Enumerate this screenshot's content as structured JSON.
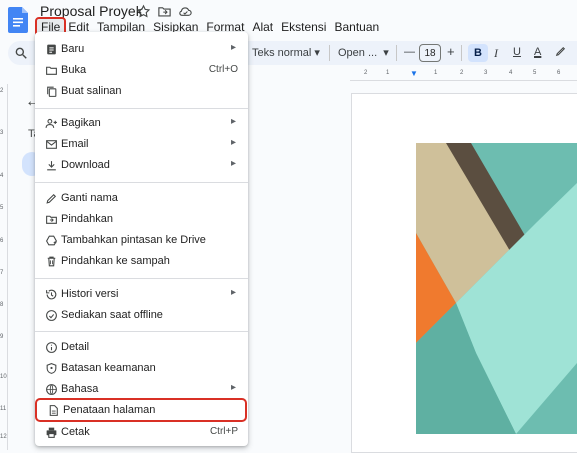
{
  "app": {
    "title": "Proposal Proyek",
    "menus": [
      "File",
      "Edit",
      "Tampilan",
      "Sisipkan",
      "Format",
      "Alat",
      "Ekstensi",
      "Bantuan"
    ],
    "active_menu": "File"
  },
  "toolbar": {
    "style": "Teks normal",
    "font": "Open ...",
    "font_size": "18",
    "minus": "—",
    "plus": "+",
    "bold": "B",
    "italic": "I",
    "underline": "U",
    "text_color": "A"
  },
  "left_panel": {
    "label": "Ta"
  },
  "ruler": {
    "numbers": [
      "2",
      "1",
      "1",
      "2",
      "3",
      "4",
      "5",
      "6"
    ]
  },
  "vruler": {
    "numbers": [
      "2",
      "3",
      "4",
      "5",
      "6",
      "7",
      "8",
      "9",
      "10",
      "11",
      "12"
    ]
  },
  "file_menu": {
    "items": [
      {
        "label": "Baru",
        "icon": "doc-icon",
        "submenu": true,
        "shortcut": ""
      },
      {
        "label": "Buka",
        "icon": "folder-icon",
        "submenu": false,
        "shortcut": "Ctrl+O"
      },
      {
        "label": "Buat salinan",
        "icon": "copy-icon",
        "submenu": false,
        "shortcut": ""
      },
      {
        "label": "Bagikan",
        "icon": "share-person-icon",
        "submenu": true,
        "shortcut": ""
      },
      {
        "label": "Email",
        "icon": "email-icon",
        "submenu": true,
        "shortcut": ""
      },
      {
        "label": "Download",
        "icon": "download-icon",
        "submenu": true,
        "shortcut": ""
      },
      {
        "label": "Ganti nama",
        "icon": "pencil-icon",
        "submenu": false,
        "shortcut": ""
      },
      {
        "label": "Pindahkan",
        "icon": "move-folder-icon",
        "submenu": false,
        "shortcut": ""
      },
      {
        "label": "Tambahkan pintasan ke Drive",
        "icon": "drive-shortcut-icon",
        "submenu": false,
        "shortcut": ""
      },
      {
        "label": "Pindahkan ke sampah",
        "icon": "trash-icon",
        "submenu": false,
        "shortcut": ""
      },
      {
        "label": "Histori versi",
        "icon": "history-icon",
        "submenu": true,
        "shortcut": ""
      },
      {
        "label": "Sediakan saat offline",
        "icon": "offline-icon",
        "submenu": false,
        "shortcut": ""
      },
      {
        "label": "Detail",
        "icon": "info-icon",
        "submenu": false,
        "shortcut": ""
      },
      {
        "label": "Batasan keamanan",
        "icon": "shield-icon",
        "submenu": false,
        "shortcut": ""
      },
      {
        "label": "Bahasa",
        "icon": "globe-icon",
        "submenu": true,
        "shortcut": ""
      },
      {
        "label": "Penataan halaman",
        "icon": "page-setup-icon",
        "submenu": false,
        "shortcut": ""
      },
      {
        "label": "Cetak",
        "icon": "print-icon",
        "submenu": false,
        "shortcut": "Ctrl+P"
      }
    ],
    "highlighted_item": "Penataan halaman"
  },
  "colors": {
    "accent": "#1a73e8",
    "highlight_border": "#d93025",
    "cover_teal": "#6dbdb0",
    "cover_mint": "#9fe3d6",
    "cover_beige": "#cfc09a",
    "cover_brown": "#5b4e40",
    "cover_orange": "#f07a2e"
  }
}
